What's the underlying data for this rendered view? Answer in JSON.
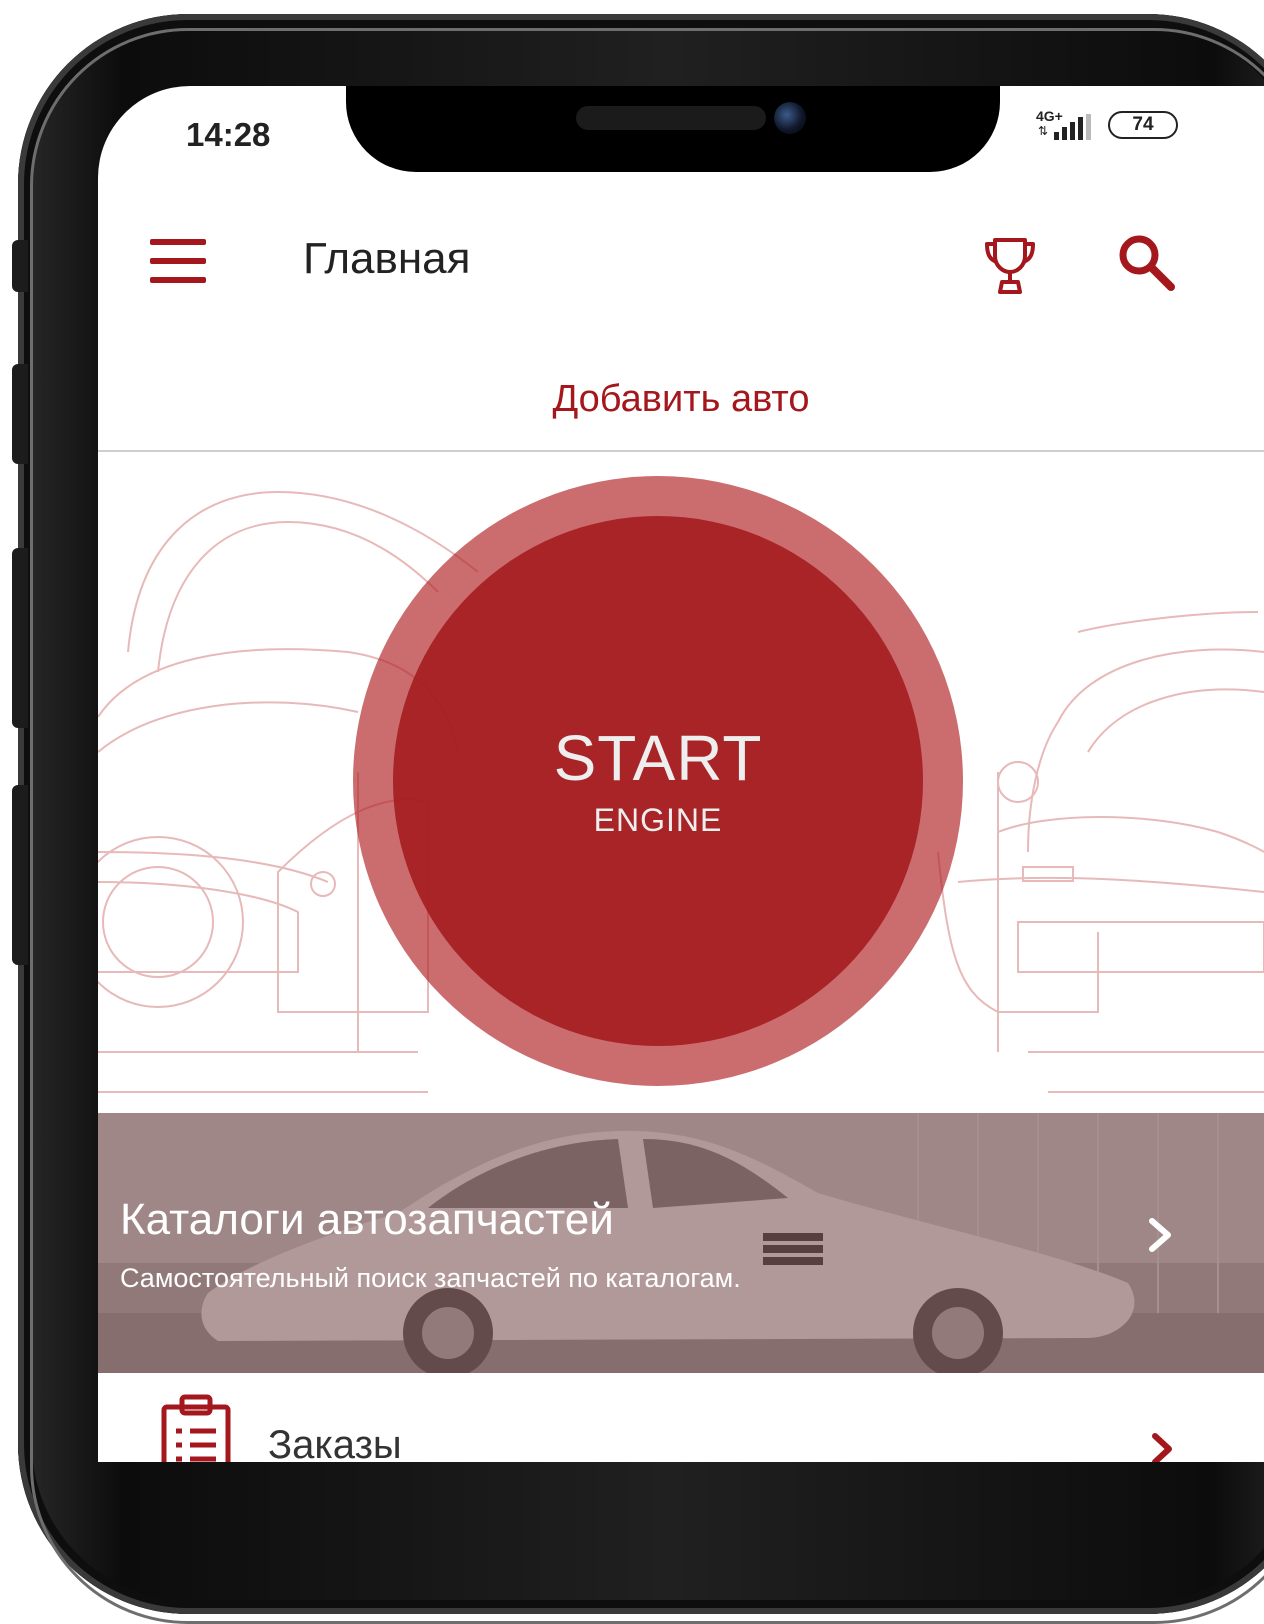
{
  "status_bar": {
    "time": "14:28",
    "network": "4G+",
    "battery": "74"
  },
  "app_bar": {
    "title": "Главная",
    "icons": [
      "menu-icon",
      "trophy-icon",
      "search-icon"
    ]
  },
  "add_car": {
    "label": "Добавить авто"
  },
  "start_button": {
    "main": "START",
    "sub": "ENGINE"
  },
  "catalog": {
    "title": "Каталоги автозапчастей",
    "subtitle": "Самостоятельный поиск запчастей по каталогам."
  },
  "orders": {
    "label": "Заказы"
  },
  "colors": {
    "accent": "#a3171d",
    "start_outer": "#c46a6c",
    "start_inner": "#ad3234"
  }
}
